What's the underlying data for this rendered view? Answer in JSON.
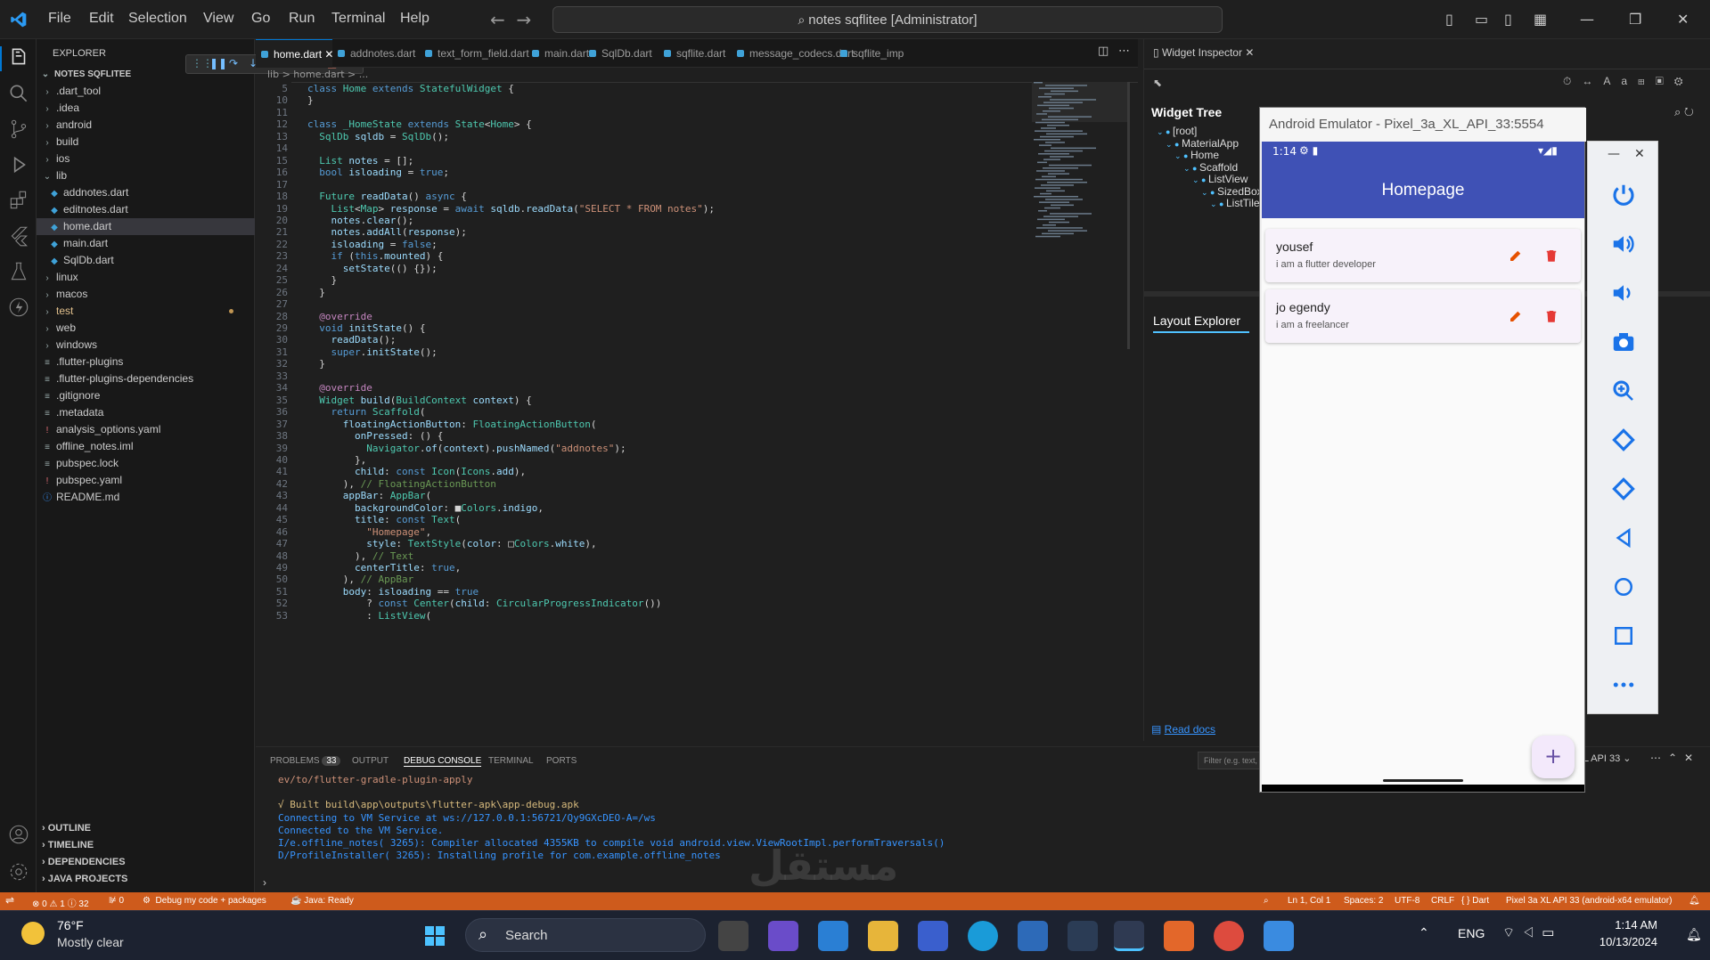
{
  "titlebar": {
    "menus": [
      "File",
      "Edit",
      "Selection",
      "View",
      "Go",
      "Run",
      "Terminal",
      "Help"
    ],
    "command_center": "notes sqflitee [Administrator]"
  },
  "explorer": {
    "header": "EXPLORER",
    "root": "NOTES SQFLITEE",
    "items": [
      {
        "label": ".dart_tool",
        "kind": "folder",
        "depth": 1
      },
      {
        "label": ".idea",
        "kind": "folder",
        "depth": 1
      },
      {
        "label": "android",
        "kind": "folder",
        "depth": 1
      },
      {
        "label": "build",
        "kind": "folder",
        "depth": 1
      },
      {
        "label": "ios",
        "kind": "folder",
        "depth": 1
      },
      {
        "label": "lib",
        "kind": "folder-open",
        "depth": 1
      },
      {
        "label": "addnotes.dart",
        "kind": "dart",
        "depth": 2
      },
      {
        "label": "editnotes.dart",
        "kind": "dart",
        "depth": 2
      },
      {
        "label": "home.dart",
        "kind": "dart",
        "depth": 2,
        "selected": true
      },
      {
        "label": "main.dart",
        "kind": "dart",
        "depth": 2
      },
      {
        "label": "SqlDb.dart",
        "kind": "dart",
        "depth": 2
      },
      {
        "label": "linux",
        "kind": "folder",
        "depth": 1
      },
      {
        "label": "macos",
        "kind": "folder",
        "depth": 1
      },
      {
        "label": "test",
        "kind": "folder",
        "depth": 1,
        "modified": true
      },
      {
        "label": "web",
        "kind": "folder",
        "depth": 1
      },
      {
        "label": "windows",
        "kind": "folder",
        "depth": 1
      },
      {
        "label": ".flutter-plugins",
        "kind": "file",
        "depth": 1
      },
      {
        "label": ".flutter-plugins-dependencies",
        "kind": "file",
        "depth": 1
      },
      {
        "label": ".gitignore",
        "kind": "file",
        "depth": 1
      },
      {
        "label": ".metadata",
        "kind": "file",
        "depth": 1
      },
      {
        "label": "analysis_options.yaml",
        "kind": "yaml",
        "depth": 1
      },
      {
        "label": "offline_notes.iml",
        "kind": "file",
        "depth": 1
      },
      {
        "label": "pubspec.lock",
        "kind": "file",
        "depth": 1
      },
      {
        "label": "pubspec.yaml",
        "kind": "yaml",
        "depth": 1
      },
      {
        "label": "README.md",
        "kind": "info",
        "depth": 1
      }
    ],
    "sections": [
      "OUTLINE",
      "TIMELINE",
      "DEPENDENCIES",
      "JAVA PROJECTS"
    ]
  },
  "tabs": [
    {
      "label": "home.dart",
      "active": true
    },
    {
      "label": "addnotes.dart"
    },
    {
      "label": "text_form_field.dart"
    },
    {
      "label": "main.dart"
    },
    {
      "label": "SqlDb.dart"
    },
    {
      "label": "sqflite.dart"
    },
    {
      "label": "message_codecs.dart"
    },
    {
      "label": "sqflite_imp"
    }
  ],
  "breadcrumb": "lib > home.dart > ...",
  "code_lines": [
    {
      "n": "5",
      "code": "class Home extends StatefulWidget {"
    },
    {
      "n": "10",
      "code": "}"
    },
    {
      "n": "11",
      "code": ""
    },
    {
      "n": "12",
      "code": "class _HomeState extends State<Home> {"
    },
    {
      "n": "13",
      "code": "  SqlDb sqldb = SqlDb();"
    },
    {
      "n": "14",
      "code": ""
    },
    {
      "n": "15",
      "code": "  List notes = [];"
    },
    {
      "n": "16",
      "code": "  bool isloading = true;"
    },
    {
      "n": "17",
      "code": ""
    },
    {
      "n": "18",
      "code": "  Future readData() async {"
    },
    {
      "n": "19",
      "code": "    List<Map> response = await sqldb.readData(\"SELECT * FROM notes\");"
    },
    {
      "n": "20",
      "code": "    notes.clear();"
    },
    {
      "n": "21",
      "code": "    notes.addAll(response);"
    },
    {
      "n": "22",
      "code": "    isloading = false;"
    },
    {
      "n": "23",
      "code": "    if (this.mounted) {"
    },
    {
      "n": "24",
      "code": "      setState(() {});"
    },
    {
      "n": "25",
      "code": "    }"
    },
    {
      "n": "26",
      "code": "  }"
    },
    {
      "n": "27",
      "code": ""
    },
    {
      "n": "28",
      "code": "  @override"
    },
    {
      "n": "29",
      "code": "  void initState() {"
    },
    {
      "n": "30",
      "code": "    readData();"
    },
    {
      "n": "31",
      "code": "    super.initState();"
    },
    {
      "n": "32",
      "code": "  }"
    },
    {
      "n": "33",
      "code": ""
    },
    {
      "n": "34",
      "code": "  @override"
    },
    {
      "n": "35",
      "code": "  Widget build(BuildContext context) {"
    },
    {
      "n": "36",
      "code": "    return Scaffold("
    },
    {
      "n": "37",
      "code": "      floatingActionButton: FloatingActionButton("
    },
    {
      "n": "38",
      "code": "        onPressed: () {"
    },
    {
      "n": "39",
      "code": "          Navigator.of(context).pushNamed(\"addnotes\");"
    },
    {
      "n": "40",
      "code": "        },"
    },
    {
      "n": "41",
      "code": "        child: const Icon(Icons.add),"
    },
    {
      "n": "42",
      "code": "      ), // FloatingActionButton"
    },
    {
      "n": "43",
      "code": "      appBar: AppBar("
    },
    {
      "n": "44",
      "code": "        backgroundColor: ■Colors.indigo,"
    },
    {
      "n": "45",
      "code": "        title: const Text("
    },
    {
      "n": "46",
      "code": "          \"Homepage\","
    },
    {
      "n": "47",
      "code": "          style: TextStyle(color: □Colors.white),"
    },
    {
      "n": "48",
      "code": "        ), // Text"
    },
    {
      "n": "49",
      "code": "        centerTitle: true,"
    },
    {
      "n": "50",
      "code": "      ), // AppBar"
    },
    {
      "n": "51",
      "code": "      body: isloading == true"
    },
    {
      "n": "52",
      "code": "          ? const Center(child: CircularProgressIndicator())"
    },
    {
      "n": "53",
      "code": "          : ListView("
    }
  ],
  "inspector": {
    "tab": "Widget Inspector",
    "widget_tree_title": "Widget Tree",
    "nodes": [
      "[root]",
      "MaterialApp",
      "Home",
      "Scaffold",
      "ListView",
      "SizedBox",
      "ListTile"
    ],
    "layout_explorer": "Layout Explorer",
    "read_docs": "Read docs"
  },
  "emulator": {
    "title": "Android Emulator - Pixel_3a_XL_API_33:5554",
    "time": "1:14",
    "app_title": "Homepage",
    "notes": [
      {
        "title": "yousef",
        "subtitle": "i am a flutter developer"
      },
      {
        "title": "jo egendy",
        "subtitle": "i am a freelancer"
      }
    ],
    "fab": "+"
  },
  "panel": {
    "tabs": [
      "PROBLEMS",
      "OUTPUT",
      "DEBUG CONSOLE",
      "TERMINAL",
      "PORTS"
    ],
    "problems_count": "33",
    "filter_placeholder": "Filter (e.g. text, !exclude)",
    "device_selector": "L API 33",
    "console": [
      {
        "text": "ev/to/flutter-gradle-plugin-apply",
        "color": "#ce9178"
      },
      {
        "text": "",
        "color": "#ccc"
      },
      {
        "text": "√ Built build\\app\\outputs\\flutter-apk\\app-debug.apk",
        "color": "#d7ba7d"
      },
      {
        "text": "Connecting to VM Service at ws://127.0.0.1:56721/Qy9GXcDEO-A=/ws",
        "color": "#3794ff"
      },
      {
        "text": "Connected to the VM Service.",
        "color": "#3794ff"
      },
      {
        "text": "I/e.offline_notes( 3265): Compiler allocated 4355KB to compile void android.view.ViewRootImpl.performTraversals()",
        "color": "#3794ff"
      },
      {
        "text": "D/ProfileInstaller( 3265): Installing profile for com.example.offline_notes",
        "color": "#3794ff"
      }
    ]
  },
  "status": {
    "errors": "0",
    "warnings": "1",
    "infos": "32",
    "ports": "0",
    "debug": "Debug my code + packages",
    "java": "Java: Ready",
    "position": "Ln 1, Col 1",
    "spaces": "Spaces: 2",
    "encoding": "UTF-8",
    "eol": "CRLF",
    "language": "Dart",
    "device": "Pixel 3a XL API 33 (android-x64 emulator)"
  },
  "taskbar": {
    "temp": "76°F",
    "weather": "Mostly clear",
    "search": "Search",
    "lang": "ENG",
    "time": "1:14 AM",
    "date": "10/13/2024"
  },
  "colors": {
    "accent": "#0078d4",
    "status": "#ce5b1c",
    "appbar": "#3f51b5",
    "edit": "#e65100",
    "delete": "#e53935"
  }
}
